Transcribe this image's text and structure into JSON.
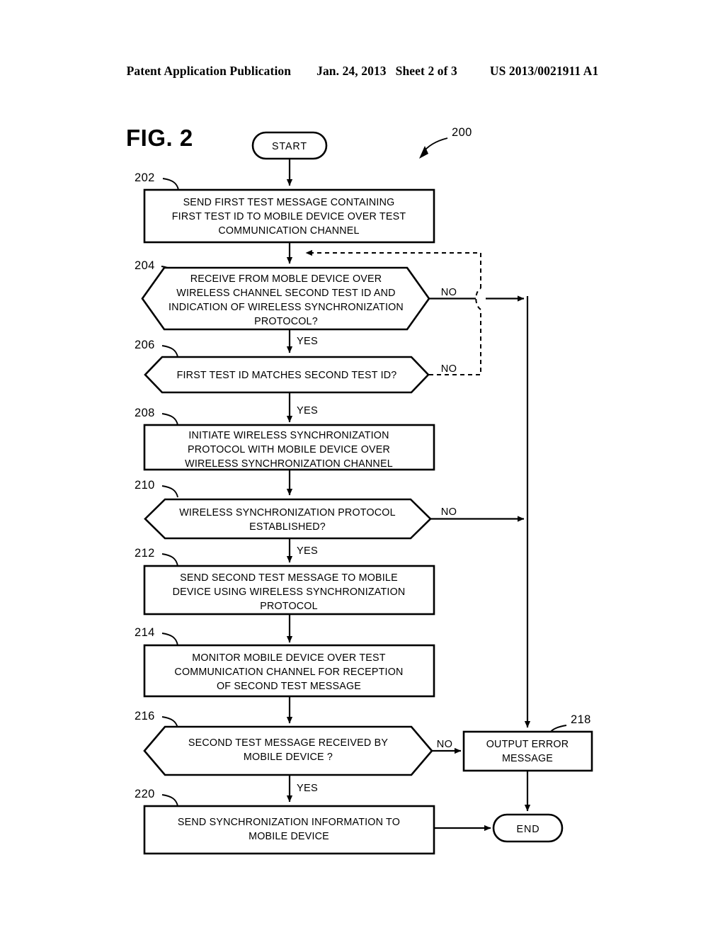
{
  "header": {
    "publication": "Patent Application Publication",
    "date": "Jan. 24, 2013",
    "sheet": "Sheet 2 of 3",
    "number": "US 2013/0021911 A1"
  },
  "figure": {
    "label": "FIG. 2",
    "diagram_ref": "200"
  },
  "terminators": {
    "start": "START",
    "end": "END"
  },
  "edge_labels": {
    "yes": "YES",
    "no": "NO"
  },
  "nodes": [
    {
      "ref": "202",
      "type": "process",
      "lines": [
        "SEND FIRST TEST MESSAGE CONTAINING",
        "FIRST TEST ID TO MOBILE DEVICE OVER TEST",
        "COMMUNICATION CHANNEL"
      ]
    },
    {
      "ref": "204",
      "type": "decision",
      "lines": [
        "RECEIVE FROM MOBLE DEVICE OVER",
        "WIRELESS CHANNEL SECOND TEST ID AND",
        "INDICATION OF WIRELESS SYNCHRONIZATION",
        "PROTOCOL?"
      ]
    },
    {
      "ref": "206",
      "type": "decision",
      "lines": [
        "FIRST TEST ID MATCHES SECOND TEST ID?"
      ]
    },
    {
      "ref": "208",
      "type": "process",
      "lines": [
        "INITIATE WIRELESS SYNCHRONIZATION",
        "PROTOCOL WITH MOBILE DEVICE OVER",
        "WIRELESS SYNCHRONIZATION CHANNEL"
      ]
    },
    {
      "ref": "210",
      "type": "decision",
      "lines": [
        "WIRELESS SYNCHRONIZATION PROTOCOL",
        "ESTABLISHED?"
      ]
    },
    {
      "ref": "212",
      "type": "process",
      "lines": [
        "SEND SECOND TEST MESSAGE TO MOBILE",
        "DEVICE USING WIRELESS SYNCHRONIZATION",
        "PROTOCOL"
      ]
    },
    {
      "ref": "214",
      "type": "process",
      "lines": [
        "MONITOR MOBILE DEVICE OVER TEST",
        "COMMUNICATION CHANNEL FOR RECEPTION",
        "OF SECOND TEST MESSAGE"
      ]
    },
    {
      "ref": "216",
      "type": "decision",
      "lines": [
        "SECOND TEST MESSAGE RECEIVED BY",
        "MOBILE DEVICE ?"
      ]
    },
    {
      "ref": "218",
      "type": "process",
      "lines": [
        "OUTPUT ERROR",
        "MESSAGE"
      ]
    },
    {
      "ref": "220",
      "type": "process",
      "lines": [
        "SEND SYNCHRONIZATION INFORMATION TO",
        "MOBILE DEVICE"
      ]
    }
  ],
  "colors": {
    "ink": "#000000",
    "paper": "#ffffff"
  }
}
